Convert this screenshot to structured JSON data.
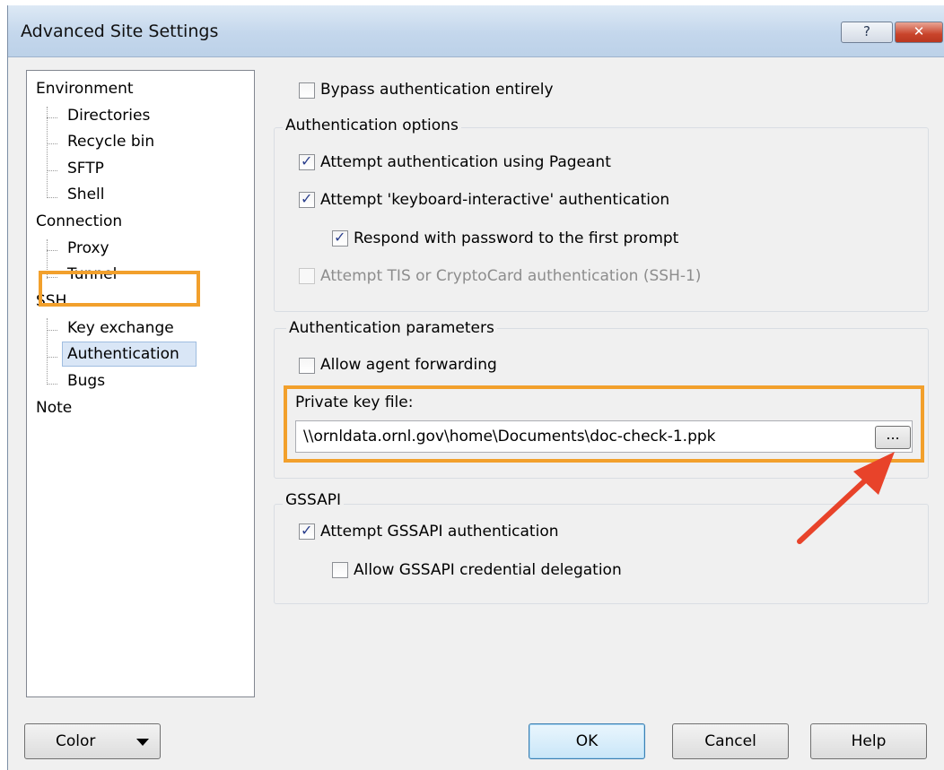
{
  "window": {
    "title": "Advanced Site Settings",
    "help_label": "?",
    "close_label": "✕"
  },
  "tree": {
    "items": [
      {
        "label": "Environment"
      },
      {
        "label": "Directories"
      },
      {
        "label": "Recycle bin"
      },
      {
        "label": "SFTP"
      },
      {
        "label": "Shell"
      },
      {
        "label": "Connection"
      },
      {
        "label": "Proxy"
      },
      {
        "label": "Tunnel"
      },
      {
        "label": "SSH"
      },
      {
        "label": "Key exchange"
      },
      {
        "label": "Authentication"
      },
      {
        "label": "Bugs"
      },
      {
        "label": "Note"
      }
    ],
    "selected": "Authentication"
  },
  "bypass": {
    "label": "Bypass authentication entirely",
    "checked": false
  },
  "auth_options": {
    "title": "Authentication options",
    "pageant": {
      "label": "Attempt authentication using Pageant",
      "checked": true
    },
    "keyboard": {
      "label": "Attempt 'keyboard-interactive' authentication",
      "checked": true
    },
    "respond": {
      "label": "Respond with password to the first prompt",
      "checked": true
    },
    "tis": {
      "label": "Attempt TIS or CryptoCard authentication (SSH-1)",
      "checked": false,
      "disabled": true
    }
  },
  "auth_params": {
    "title": "Authentication parameters",
    "agent_forwarding": {
      "label": "Allow agent forwarding",
      "checked": false
    },
    "private_key_label": "Private key file:",
    "private_key_value": "\\\\ornldata.ornl.gov\\home\\Documents\\doc-check-1.ppk",
    "browse_label": "..."
  },
  "gssapi": {
    "title": "GSSAPI",
    "attempt": {
      "label": "Attempt GSSAPI authentication",
      "checked": true
    },
    "delegation": {
      "label": "Allow GSSAPI credential delegation",
      "checked": false
    }
  },
  "buttons": {
    "color": "Color",
    "ok": "OK",
    "cancel": "Cancel",
    "help": "Help"
  },
  "colors": {
    "highlight": "#f2a02c",
    "arrow": "#e8432a"
  }
}
